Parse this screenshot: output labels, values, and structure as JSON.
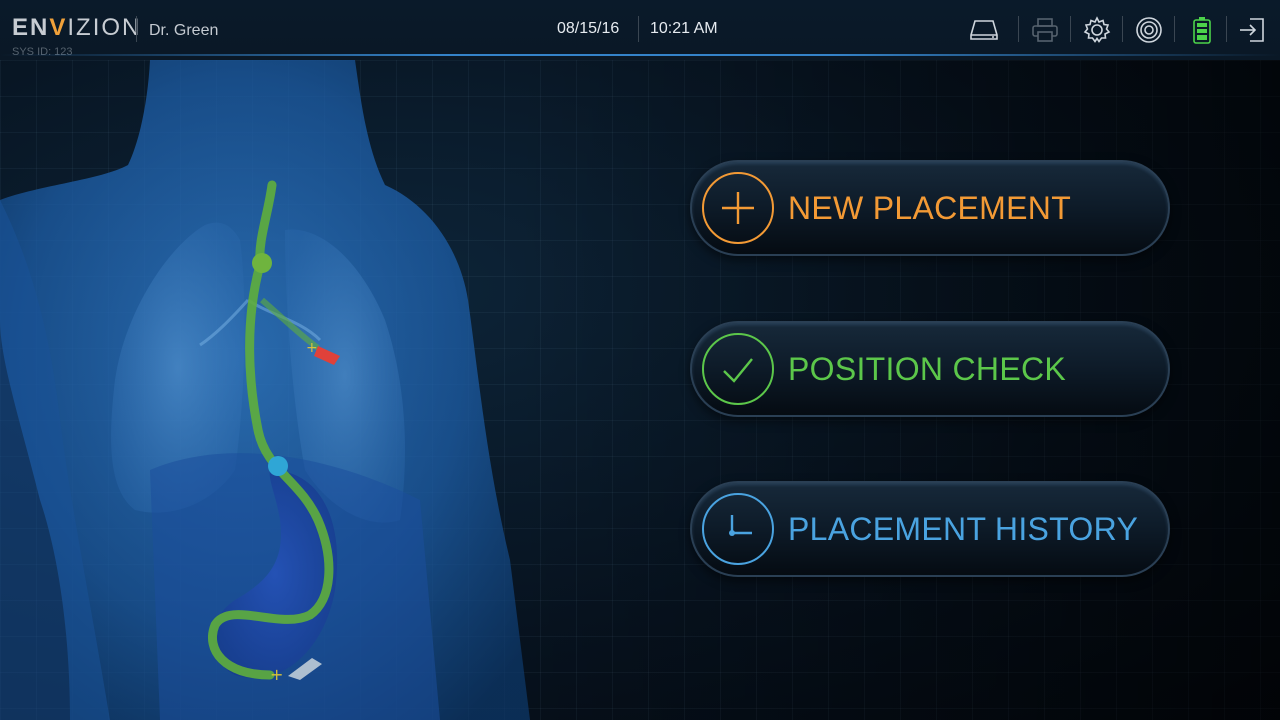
{
  "app": {
    "logo_part1": "EN",
    "logo_part2": "V",
    "logo_part3": "IZION",
    "sys_id": "SYS ID: 123",
    "user": "Dr. Green"
  },
  "header": {
    "date": "08/15/16",
    "time": "10:21 AM"
  },
  "toolbar_icons": [
    "drive-icon",
    "printer-icon",
    "gear-icon",
    "signal-icon",
    "battery-icon",
    "logout-icon"
  ],
  "menu": {
    "new_placement": {
      "label": "NEW PLACEMENT",
      "color": "#f39a35",
      "icon": "plus-icon"
    },
    "position_check": {
      "label": "POSITION CHECK",
      "color": "#5cc74a",
      "icon": "check-icon"
    },
    "placement_history": {
      "label": "PLACEMENT HISTORY",
      "color": "#4aa3e0",
      "icon": "clock-icon"
    }
  },
  "colors": {
    "accent_orange": "#f39a35",
    "accent_green": "#5cc74a",
    "accent_blue": "#4aa3e0",
    "battery_green": "#4cd34a",
    "tube_green": "#5fae3c",
    "marker_red": "#e0413a"
  }
}
